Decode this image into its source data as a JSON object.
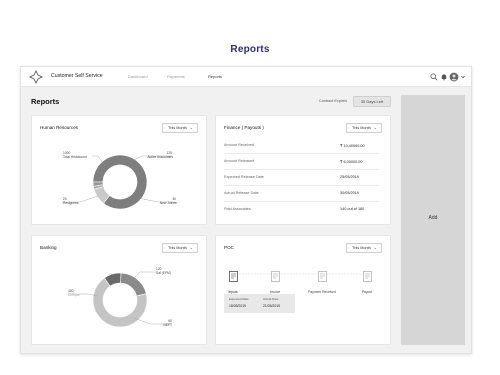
{
  "page": {
    "title": "Reports"
  },
  "topbar": {
    "app_name": "Customer Self Service",
    "nav": [
      {
        "label": "Dashboard",
        "active": false
      },
      {
        "label": "Payments",
        "active": false
      },
      {
        "label": "Reports",
        "active": true
      }
    ],
    "icons": [
      "search-icon",
      "bell-icon",
      "user-avatar",
      "chevron-down-icon"
    ]
  },
  "main": {
    "title": "Reports",
    "contract_expiry_label": "Contract Expires",
    "contract_expiry_value": "30 Days Left"
  },
  "cards": {
    "hr": {
      "title": "Human Resources",
      "filter": "This Month",
      "chart_data": {
        "type": "pie",
        "categories": [
          "Total Headcount",
          "Active Associates",
          "Resignees",
          "New Joinee"
        ],
        "values": [
          1000,
          120,
          20,
          30
        ],
        "value_labels": [
          "1000",
          "120",
          "20",
          "30"
        ],
        "colors": [
          "#7e7e7e",
          "#c9c9c9",
          "#a8a8a8",
          "#959595"
        ]
      }
    },
    "finance": {
      "title": "Finance ( Payouts )",
      "filter": "This Month",
      "rows": [
        {
          "label": "Amount Received",
          "value": "₹ 10,40090.00"
        },
        {
          "label": "Amount Released",
          "value": "₹ 6,00000.00"
        },
        {
          "label": "Expected Release Date",
          "value": "25/05/2019"
        },
        {
          "label": "Actual Release Date",
          "value": "30/05/2019"
        },
        {
          "label": "Paid Associates",
          "value": "140 out of 180"
        }
      ]
    },
    "banking": {
      "title": "Banking",
      "filter": "This Month",
      "chart_data": {
        "type": "pie",
        "categories": [
          "Sal (EFM)",
          "Cheque",
          "NEFT"
        ],
        "values": [
          120,
          400,
          60
        ],
        "value_labels": [
          "120",
          "400",
          "60"
        ],
        "colors": [
          "#8a8a8a",
          "#c4c4c4",
          "#6a6a6a"
        ]
      }
    },
    "poc": {
      "title": "POC",
      "filter": "This Month",
      "steps": [
        {
          "label": "Inputs",
          "active": true
        },
        {
          "label": "Invoice",
          "active": false
        },
        {
          "label": "Payment Received",
          "active": false
        },
        {
          "label": "Payout",
          "active": false
        }
      ],
      "expected_date_label": "Expected Date",
      "expected_date_value": "18/05/2019",
      "actual_date_label": "Actual Date",
      "actual_date_value": "21/05/2019"
    }
  },
  "add_panel": {
    "label": "Add"
  }
}
